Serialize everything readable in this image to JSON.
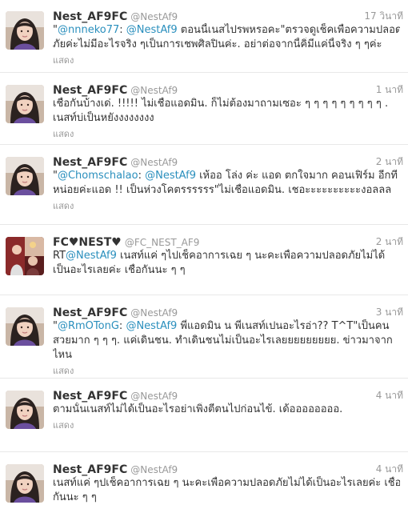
{
  "tweets": [
    {
      "name": "Nest_AF9FC",
      "handle": "@NestAf9",
      "time": "17 วินาที",
      "line1": [
        {
          "t": "\"",
          "m": false
        },
        {
          "t": "@nnneko77",
          "m": true
        },
        {
          "t": ": ",
          "m": false
        },
        {
          "t": "@NestAf9",
          "m": true
        },
        {
          "t": " ตอนนี้เนสไปรพหรอคะ\"ตรวจดูเช็คเพื่อความปลอด",
          "m": false
        }
      ],
      "line2": [
        {
          "t": "ภัยค่ะไม่มีอะไรจริง ๆเป็นการเชพศิลปินค่ะ. อย่าต่อจากนี้คิ่มีแค่นี้จริง ๆ ๆค่ะ",
          "m": false
        }
      ],
      "expand": "แสดง",
      "avatar": "avatar-portrait"
    },
    {
      "name": "Nest_AF9FC",
      "handle": "@NestAf9",
      "time": "1 นาที",
      "line1": [
        {
          "t": "เชื่อกันบ้างเด่. !!!!! ไม่เชื่อแอดมิน. ก็ไม่ต้องมาถามเซอะ ๆ ๆ ๆ ๆ ๆ ๆ ๆ ๆ ๆ .",
          "m": false
        }
      ],
      "line2": [
        {
          "t": "เนสท์บ่เป็นหยังงงงงงงง",
          "m": false
        }
      ],
      "expand": "แสดง",
      "avatar": "avatar-portrait"
    },
    {
      "name": "Nest_AF9FC",
      "handle": "@NestAf9",
      "time": "2 นาที",
      "line1": [
        {
          "t": "\"",
          "m": false
        },
        {
          "t": "@Chomschalao",
          "m": true
        },
        {
          "t": ": ",
          "m": false
        },
        {
          "t": "@NestAf9",
          "m": true
        },
        {
          "t": " เห้ออ โล่ง ค่ะ แอด ตกใจมาก คอนเฟิร์ม อีกที",
          "m": false
        }
      ],
      "line2": [
        {
          "t": "หน่อยค่ะแอด !! เป็นห่วงโคตรรรรรร\"ไม่เชื่อแอดมิน. เชอะะะะะะะะะะงอลลล",
          "m": false
        }
      ],
      "expand": "แสดง",
      "avatar": "avatar-portrait"
    },
    {
      "name": "FC♥NEST♥",
      "handle": "@FC_NEST_AF9",
      "time": "2 นาที",
      "line1": [
        {
          "t": "RT",
          "m": false
        },
        {
          "t": "@NestAf9",
          "m": true
        },
        {
          "t": " เนสท์แค่ ๆไปเช็คอาการเฉย ๆ นะคะเพื่อความปลอดภัยไม่ได้",
          "m": false
        }
      ],
      "line2": [
        {
          "t": "เป็นอะไรเลยค่ะ เชื่อกันนะ ๆ ๆ",
          "m": false
        }
      ],
      "expand": "",
      "avatar": "avatar-fc"
    },
    {
      "name": "Nest_AF9FC",
      "handle": "@NestAf9",
      "time": "3 นาที",
      "line1": [
        {
          "t": "\"",
          "m": false
        },
        {
          "t": "@RmOTonG",
          "m": true
        },
        {
          "t": ": ",
          "m": false
        },
        {
          "t": "@NestAf9",
          "m": true
        },
        {
          "t": " พี่แอดมิน น พี่เนสท์เปนอะไรอ่า?? T^T\"เป็นคน",
          "m": false
        }
      ],
      "line2": [
        {
          "t": "สวยมาก ๆ ๆ ๆ. แค่เดินชน. ทำเดินชนไม่เป็นอะไรเลยยยยยยยยย. ข่าวมาจาก",
          "m": false
        }
      ],
      "line3": [
        {
          "t": "ไหน",
          "m": false
        }
      ],
      "expand": "แสดง",
      "avatar": "avatar-portrait"
    },
    {
      "name": "Nest_AF9FC",
      "handle": "@NestAf9",
      "time": "4 นาที",
      "line1": [
        {
          "t": "ตามนั้นเนสท์ไม่ได้เป็นอะไรอย่าเพิ่งตีตนไปก่อนไข้. เด้ออออออออ.",
          "m": false
        }
      ],
      "line2": [],
      "expand": "แสดง",
      "avatar": "avatar-portrait"
    },
    {
      "name": "Nest_AF9FC",
      "handle": "@NestAf9",
      "time": "4 นาที",
      "line1": [
        {
          "t": "เนสท์แค่ ๆปเช็คอาการเฉย ๆ นะคะเพื่อความปลอดภัยไม่ได้เป็นอะไรเลยค่ะ เชื่อ",
          "m": false
        }
      ],
      "line2": [
        {
          "t": "กันนะ ๆ ๆ",
          "m": false
        }
      ],
      "expand": "",
      "avatar": "avatar-portrait"
    }
  ],
  "colors": {
    "name": "#333333",
    "meta": "#999999",
    "mention": "#2a8fbd",
    "divider": "#e8e8e8"
  }
}
